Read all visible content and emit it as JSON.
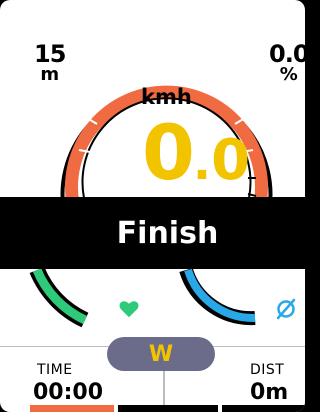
{
  "gauge": {
    "speed_unit": "kmh",
    "speed_int": "0",
    "speed_dot": ".",
    "speed_frac": "0",
    "accent_orange": "#f06a42",
    "speed_color": "#f2c400"
  },
  "left_corner": {
    "value": "15",
    "unit": "m"
  },
  "right_corner": {
    "value": "0.0",
    "unit": "%"
  },
  "banner": {
    "label": "Finish"
  },
  "zones": {
    "heart_icon": "heart-icon",
    "heart_color": "#2fc97a",
    "cadence_icon": "cadence-icon",
    "cadence_color": "#29a8e8"
  },
  "mode_pill": {
    "label": "W",
    "bg": "#6a6c89"
  },
  "fields": {
    "time": {
      "label": "TIME",
      "value": "00:00"
    },
    "dist": {
      "label": "DIST",
      "value": "0m"
    }
  }
}
